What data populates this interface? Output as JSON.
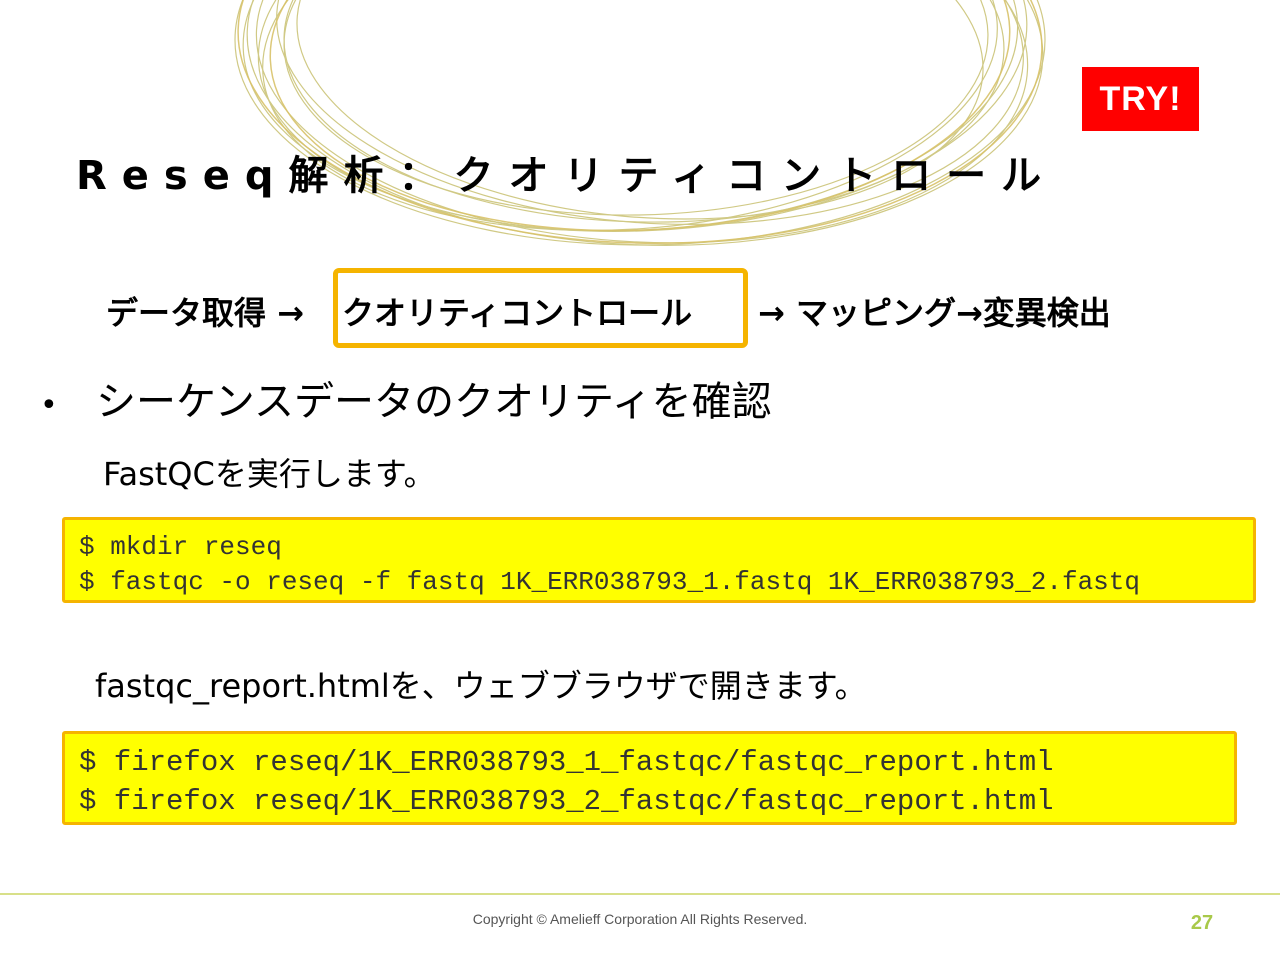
{
  "slide": {
    "badge": "TRY!",
    "title": "Reseq解析：クオリティコントロール",
    "workflow": {
      "before": "データ取得 →",
      "current": "クオリティコントロール",
      "after": "→ マッピング→変異検出"
    },
    "bullet": "シーケンスデータのクオリティを確認",
    "step1_text": "FastQCを実行します。",
    "code1": [
      "$ mkdir reseq",
      "$ fastqc -o reseq -f fastq 1K_ERR038793_1.fastq 1K_ERR038793_2.fastq"
    ],
    "step2_text": "fastqc_report.htmlを、ウェブブラウザで開きます。",
    "code2": [
      "$ firefox reseq/1K_ERR038793_1_fastqc/fastqc_report.html",
      "$ firefox reseq/1K_ERR038793_2_fastqc/fastqc_report.html"
    ]
  },
  "footer": {
    "copyright": "Copyright © Amelieff Corporation All Rights Reserved.",
    "page_number": "27"
  },
  "colors": {
    "badge_bg": "#ff0000",
    "highlight_border": "#f5b400",
    "code_bg": "#ffff00",
    "page_number": "#a9c94a",
    "swirl": "#c8c070"
  }
}
